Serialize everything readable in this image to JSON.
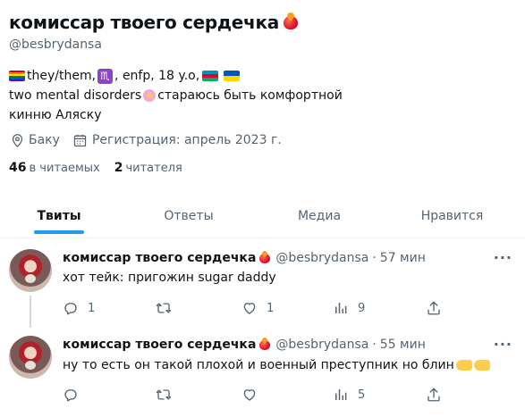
{
  "profile": {
    "display_name": "комиссар твоего сердечка",
    "handle": "@besbrydansa",
    "bio": {
      "line1_a": "they/them,",
      "line1_b": ", enfp, 18 y.o,",
      "line2_a": "two mental disorders",
      "line2_b": "стараюсь быть комфортной",
      "line3": "кинню Аляску"
    },
    "location": "Баку",
    "joined": "Регистрация: апрель 2023 г.",
    "following_count": "46",
    "following_label": "в читаемых",
    "followers_count": "2",
    "followers_label": "читателя"
  },
  "icons": {
    "location": "map-pin-icon",
    "calendar": "calendar-icon",
    "reply": "reply-icon",
    "retweet": "retweet-icon",
    "like": "heart-icon",
    "views": "views-icon",
    "share": "share-icon",
    "more": "more-icon"
  },
  "tabs": [
    {
      "label": "Твиты",
      "active": true
    },
    {
      "label": "Ответы",
      "active": false
    },
    {
      "label": "Медиа",
      "active": false
    },
    {
      "label": "Нравится",
      "active": false
    }
  ],
  "tweets": [
    {
      "name": "комиссар твоего сердечка",
      "handle": "@besbrydansa",
      "dot": "·",
      "time": "57 мин",
      "text": "хот тейк: пригожин sugar daddy",
      "replies": "1",
      "retweets": "",
      "likes": "1",
      "views": "9"
    },
    {
      "name": "комиссар твоего сердечка",
      "handle": "@besbrydansa",
      "dot": "·",
      "time": "55 мин",
      "text": "ну то есть он такой плохой и военный преступник но блин",
      "replies": "",
      "retweets": "",
      "likes": "",
      "views": "5"
    }
  ],
  "colors": {
    "accent": "#1d9bf0",
    "text_primary": "#0f1419",
    "text_secondary": "#536471"
  }
}
